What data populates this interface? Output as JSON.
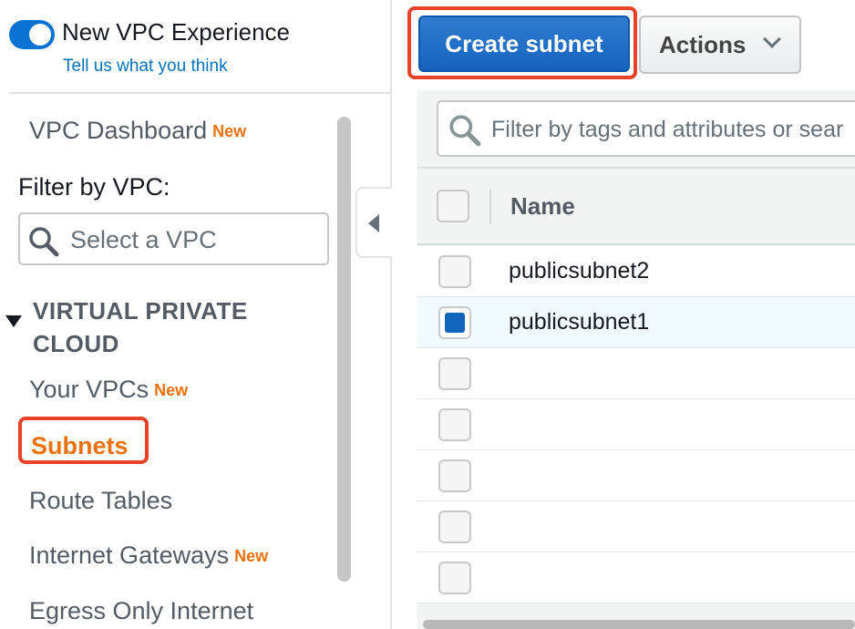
{
  "sidebar": {
    "experience_toggle_label": "New VPC Experience",
    "feedback_link": "Tell us what you think",
    "dashboard_label": "VPC Dashboard",
    "dashboard_badge": "New",
    "filter_label": "Filter by VPC:",
    "vpc_select_placeholder": "Select a VPC",
    "section_header": "VIRTUAL PRIVATE CLOUD",
    "items": [
      {
        "label": "Your VPCs",
        "badge": "New"
      },
      {
        "label": "Subnets",
        "badge": ""
      },
      {
        "label": "Route Tables",
        "badge": ""
      },
      {
        "label": "Internet Gateways",
        "badge": "New"
      },
      {
        "label": "Egress Only Internet",
        "badge": ""
      }
    ]
  },
  "toolbar": {
    "create_label": "Create subnet",
    "actions_label": "Actions"
  },
  "filter": {
    "placeholder": "Filter by tags and attributes or sear"
  },
  "table": {
    "columns": [
      "Name"
    ],
    "rows": [
      {
        "name": "publicsubnet2",
        "selected": false
      },
      {
        "name": "publicsubnet1",
        "selected": true
      },
      {
        "name": "",
        "selected": false
      },
      {
        "name": "",
        "selected": false
      },
      {
        "name": "",
        "selected": false
      },
      {
        "name": "",
        "selected": false
      },
      {
        "name": "",
        "selected": false
      }
    ]
  },
  "colors": {
    "accent_blue": "#0972d3",
    "link_blue": "#0073bb",
    "active_orange": "#ec7211",
    "highlight_red": "#e8412c"
  },
  "icons": [
    "toggle-switch",
    "search-icon",
    "caret-down-icon",
    "chevron-left-icon",
    "chevron-down-icon"
  ]
}
